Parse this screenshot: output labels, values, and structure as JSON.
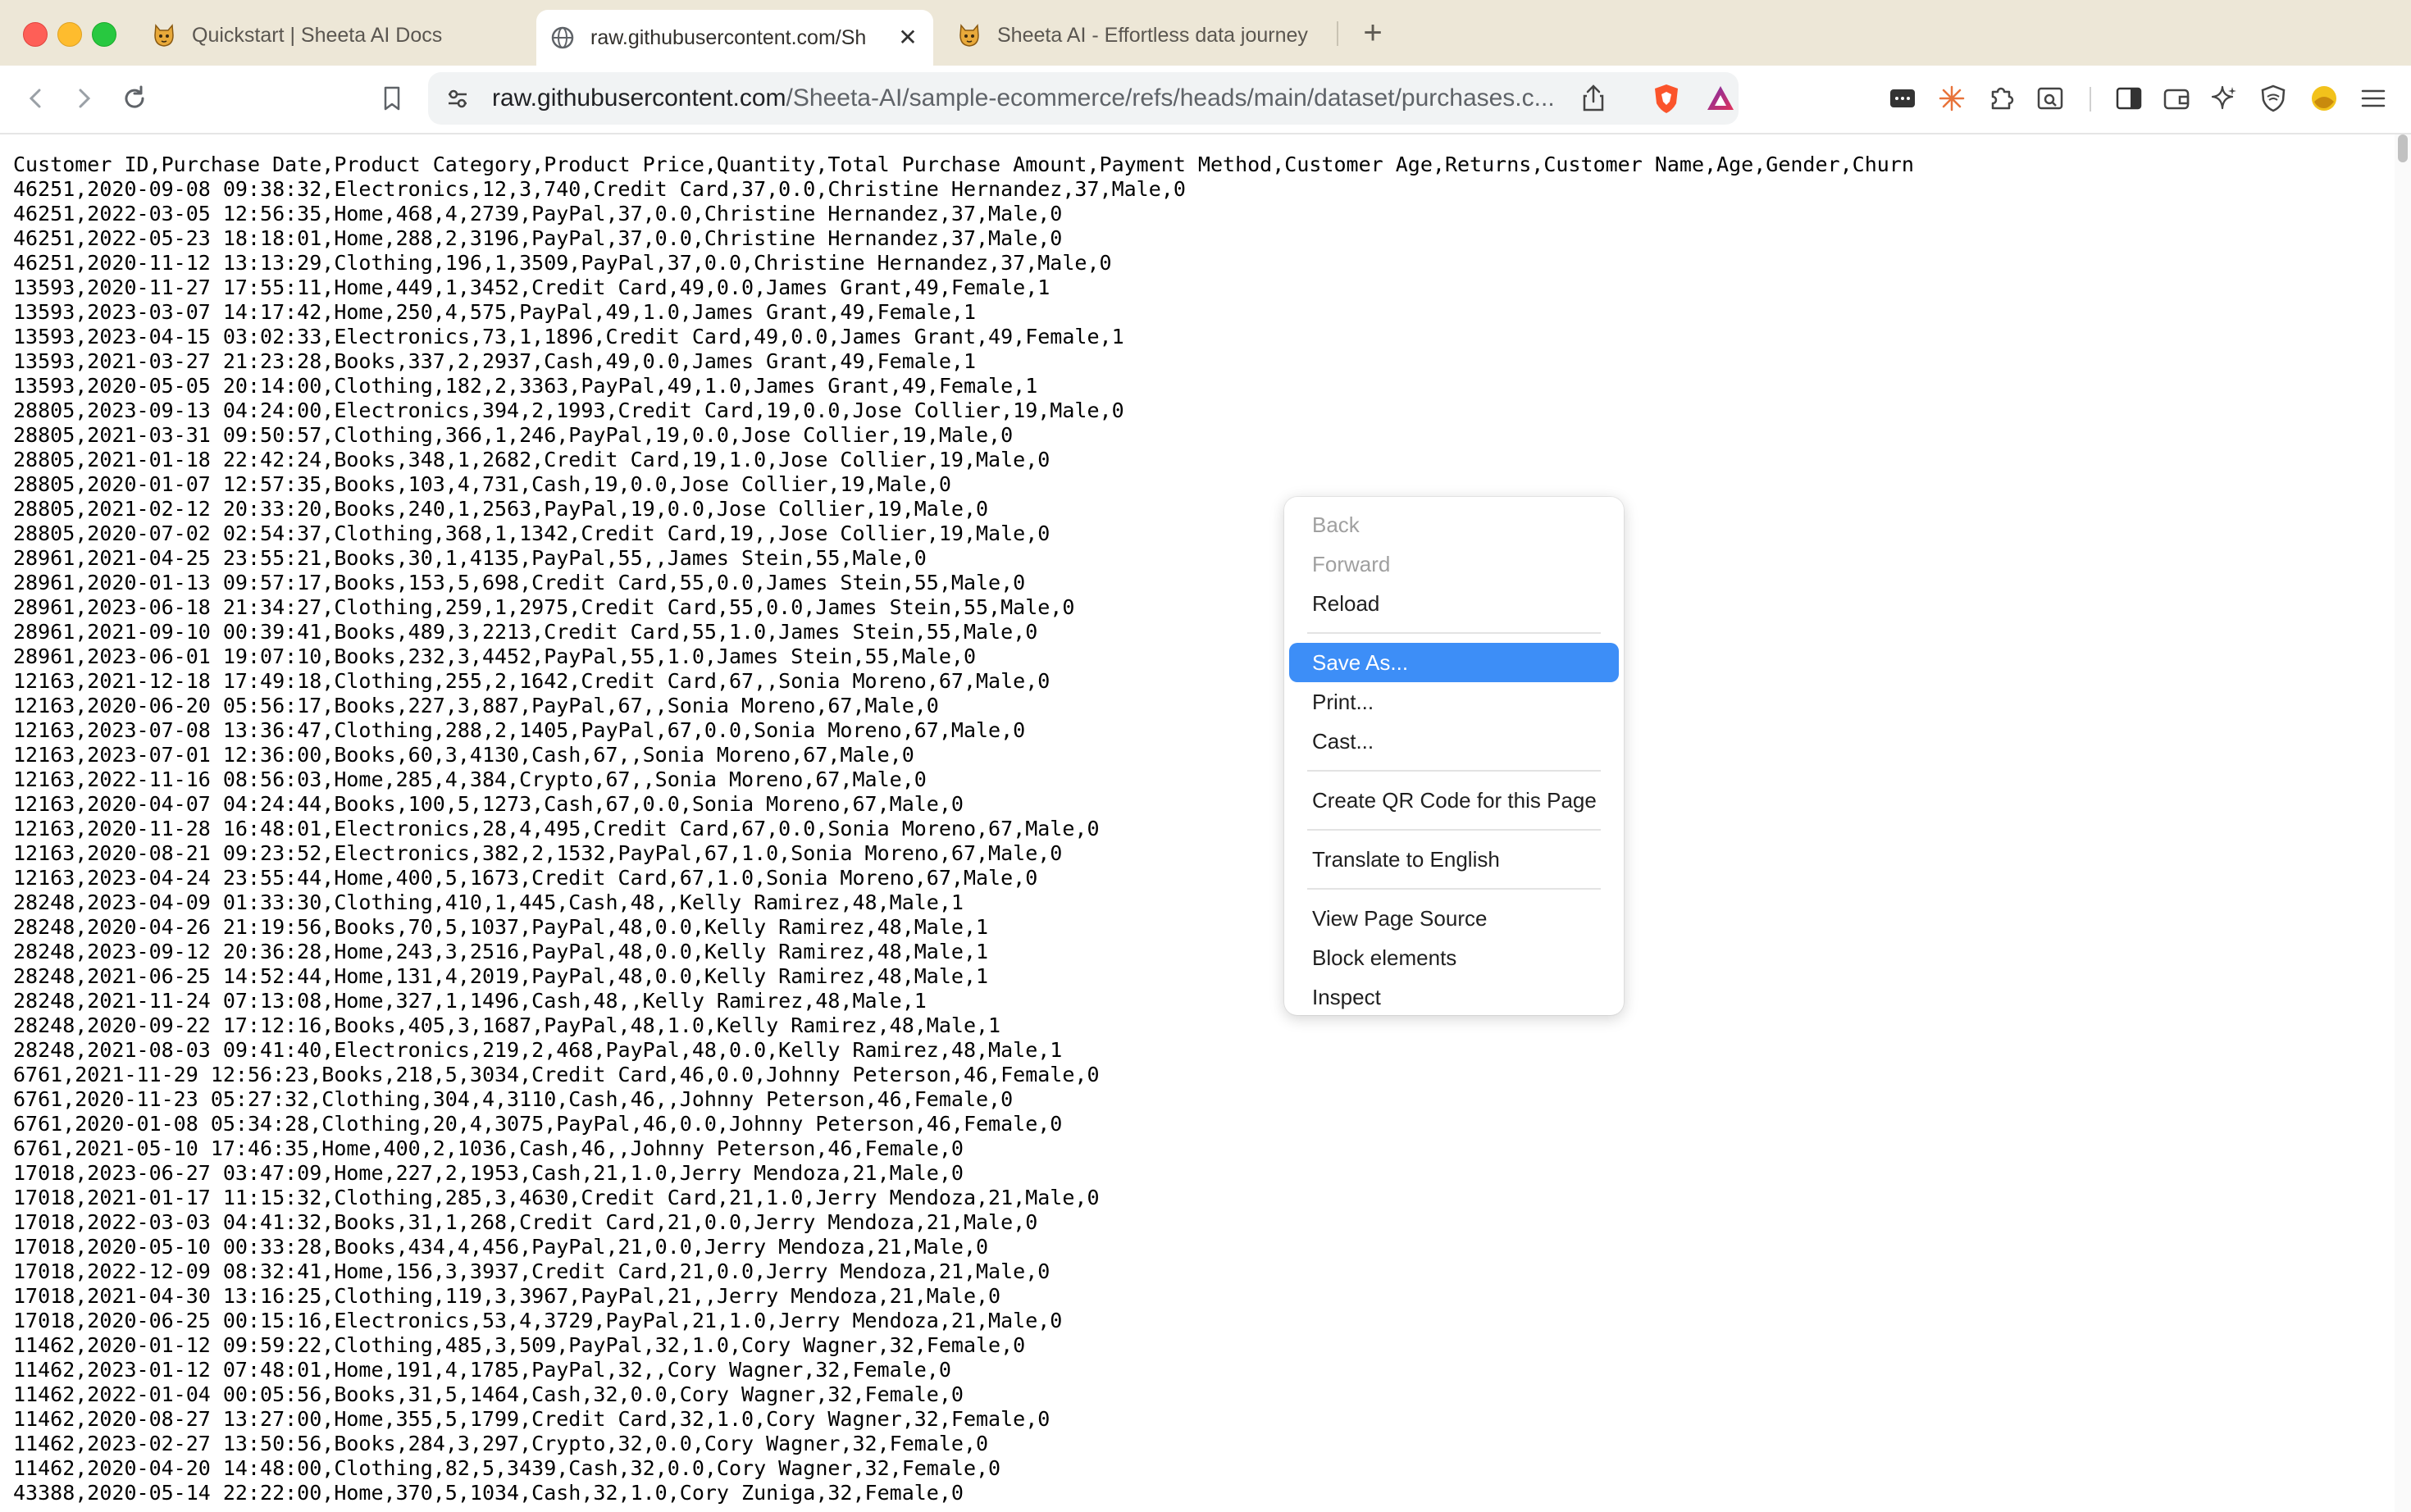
{
  "tabs": [
    {
      "title": "Quickstart | Sheeta AI Docs",
      "favicon": "sheeta-logo-icon"
    },
    {
      "title": "raw.githubusercontent.com/Sh",
      "favicon": "globe-icon",
      "active": true
    },
    {
      "title": "Sheeta AI - Effortless data journey",
      "favicon": "sheeta-logo-icon"
    }
  ],
  "address_bar": {
    "host": "raw.githubusercontent.com",
    "path": "/Sheeta-AI/sample-ecommerce/refs/heads/main/dataset/purchases.c..."
  },
  "csv_lines": [
    "Customer ID,Purchase Date,Product Category,Product Price,Quantity,Total Purchase Amount,Payment Method,Customer Age,Returns,Customer Name,Age,Gender,Churn",
    "46251,2020-09-08 09:38:32,Electronics,12,3,740,Credit Card,37,0.0,Christine Hernandez,37,Male,0",
    "46251,2022-03-05 12:56:35,Home,468,4,2739,PayPal,37,0.0,Christine Hernandez,37,Male,0",
    "46251,2022-05-23 18:18:01,Home,288,2,3196,PayPal,37,0.0,Christine Hernandez,37,Male,0",
    "46251,2020-11-12 13:13:29,Clothing,196,1,3509,PayPal,37,0.0,Christine Hernandez,37,Male,0",
    "13593,2020-11-27 17:55:11,Home,449,1,3452,Credit Card,49,0.0,James Grant,49,Female,1",
    "13593,2023-03-07 14:17:42,Home,250,4,575,PayPal,49,1.0,James Grant,49,Female,1",
    "13593,2023-04-15 03:02:33,Electronics,73,1,1896,Credit Card,49,0.0,James Grant,49,Female,1",
    "13593,2021-03-27 21:23:28,Books,337,2,2937,Cash,49,0.0,James Grant,49,Female,1",
    "13593,2020-05-05 20:14:00,Clothing,182,2,3363,PayPal,49,1.0,James Grant,49,Female,1",
    "28805,2023-09-13 04:24:00,Electronics,394,2,1993,Credit Card,19,0.0,Jose Collier,19,Male,0",
    "28805,2021-03-31 09:50:57,Clothing,366,1,246,PayPal,19,0.0,Jose Collier,19,Male,0",
    "28805,2021-01-18 22:42:24,Books,348,1,2682,Credit Card,19,1.0,Jose Collier,19,Male,0",
    "28805,2020-01-07 12:57:35,Books,103,4,731,Cash,19,0.0,Jose Collier,19,Male,0",
    "28805,2021-02-12 20:33:20,Books,240,1,2563,PayPal,19,0.0,Jose Collier,19,Male,0",
    "28805,2020-07-02 02:54:37,Clothing,368,1,1342,Credit Card,19,,Jose Collier,19,Male,0",
    "28961,2021-04-25 23:55:21,Books,30,1,4135,PayPal,55,,James Stein,55,Male,0",
    "28961,2020-01-13 09:57:17,Books,153,5,698,Credit Card,55,0.0,James Stein,55,Male,0",
    "28961,2023-06-18 21:34:27,Clothing,259,1,2975,Credit Card,55,0.0,James Stein,55,Male,0",
    "28961,2021-09-10 00:39:41,Books,489,3,2213,Credit Card,55,1.0,James Stein,55,Male,0",
    "28961,2023-06-01 19:07:10,Books,232,3,4452,PayPal,55,1.0,James Stein,55,Male,0",
    "12163,2021-12-18 17:49:18,Clothing,255,2,1642,Credit Card,67,,Sonia Moreno,67,Male,0",
    "12163,2020-06-20 05:56:17,Books,227,3,887,PayPal,67,,Sonia Moreno,67,Male,0",
    "12163,2023-07-08 13:36:47,Clothing,288,2,1405,PayPal,67,0.0,Sonia Moreno,67,Male,0",
    "12163,2023-07-01 12:36:00,Books,60,3,4130,Cash,67,,Sonia Moreno,67,Male,0",
    "12163,2022-11-16 08:56:03,Home,285,4,384,Crypto,67,,Sonia Moreno,67,Male,0",
    "12163,2020-04-07 04:24:44,Books,100,5,1273,Cash,67,0.0,Sonia Moreno,67,Male,0",
    "12163,2020-11-28 16:48:01,Electronics,28,4,495,Credit Card,67,0.0,Sonia Moreno,67,Male,0",
    "12163,2020-08-21 09:23:52,Electronics,382,2,1532,PayPal,67,1.0,Sonia Moreno,67,Male,0",
    "12163,2023-04-24 23:55:44,Home,400,5,1673,Credit Card,67,1.0,Sonia Moreno,67,Male,0",
    "28248,2023-04-09 01:33:30,Clothing,410,1,445,Cash,48,,Kelly Ramirez,48,Male,1",
    "28248,2020-04-26 21:19:56,Books,70,5,1037,PayPal,48,0.0,Kelly Ramirez,48,Male,1",
    "28248,2023-09-12 20:36:28,Home,243,3,2516,PayPal,48,0.0,Kelly Ramirez,48,Male,1",
    "28248,2021-06-25 14:52:44,Home,131,4,2019,PayPal,48,0.0,Kelly Ramirez,48,Male,1",
    "28248,2021-11-24 07:13:08,Home,327,1,1496,Cash,48,,Kelly Ramirez,48,Male,1",
    "28248,2020-09-22 17:12:16,Books,405,3,1687,PayPal,48,1.0,Kelly Ramirez,48,Male,1",
    "28248,2021-08-03 09:41:40,Electronics,219,2,468,PayPal,48,0.0,Kelly Ramirez,48,Male,1",
    "6761,2021-11-29 12:56:23,Books,218,5,3034,Credit Card,46,0.0,Johnny Peterson,46,Female,0",
    "6761,2020-11-23 05:27:32,Clothing,304,4,3110,Cash,46,,Johnny Peterson,46,Female,0",
    "6761,2020-01-08 05:34:28,Clothing,20,4,3075,PayPal,46,0.0,Johnny Peterson,46,Female,0",
    "6761,2021-05-10 17:46:35,Home,400,2,1036,Cash,46,,Johnny Peterson,46,Female,0",
    "17018,2023-06-27 03:47:09,Home,227,2,1953,Cash,21,1.0,Jerry Mendoza,21,Male,0",
    "17018,2021-01-17 11:15:32,Clothing,285,3,4630,Credit Card,21,1.0,Jerry Mendoza,21,Male,0",
    "17018,2022-03-03 04:41:32,Books,31,1,268,Credit Card,21,0.0,Jerry Mendoza,21,Male,0",
    "17018,2020-05-10 00:33:28,Books,434,4,456,PayPal,21,0.0,Jerry Mendoza,21,Male,0",
    "17018,2022-12-09 08:32:41,Home,156,3,3937,Credit Card,21,0.0,Jerry Mendoza,21,Male,0",
    "17018,2021-04-30 13:16:25,Clothing,119,3,3967,PayPal,21,,Jerry Mendoza,21,Male,0",
    "17018,2020-06-25 00:15:16,Electronics,53,4,3729,PayPal,21,1.0,Jerry Mendoza,21,Male,0",
    "11462,2020-01-12 09:59:22,Clothing,485,3,509,PayPal,32,1.0,Cory Wagner,32,Female,0",
    "11462,2023-01-12 07:48:01,Home,191,4,1785,PayPal,32,,Cory Wagner,32,Female,0",
    "11462,2022-01-04 00:05:56,Books,31,5,1464,Cash,32,0.0,Cory Wagner,32,Female,0",
    "11462,2020-08-27 13:27:00,Home,355,5,1799,Credit Card,32,1.0,Cory Wagner,32,Female,0",
    "11462,2023-02-27 13:50:56,Books,284,3,297,Crypto,32,0.0,Cory Wagner,32,Female,0",
    "11462,2020-04-20 14:48:00,Clothing,82,5,3439,Cash,32,0.0,Cory Wagner,32,Female,0",
    "43388,2020-05-14 22:22:00,Home,370,5,1034,Cash,32,1.0,Cory Zuniga,32,Female,0"
  ],
  "context_menu": {
    "groups": [
      [
        {
          "label": "Back",
          "disabled": true
        },
        {
          "label": "Forward",
          "disabled": true
        },
        {
          "label": "Reload",
          "disabled": false
        }
      ],
      [
        {
          "label": "Save As...",
          "selected": true
        },
        {
          "label": "Print..."
        },
        {
          "label": "Cast..."
        }
      ],
      [
        {
          "label": "Create QR Code for this Page"
        }
      ],
      [
        {
          "label": "Translate to English"
        }
      ],
      [
        {
          "label": "View Page Source"
        },
        {
          "label": "Block elements"
        },
        {
          "label": "Inspect"
        }
      ]
    ]
  }
}
